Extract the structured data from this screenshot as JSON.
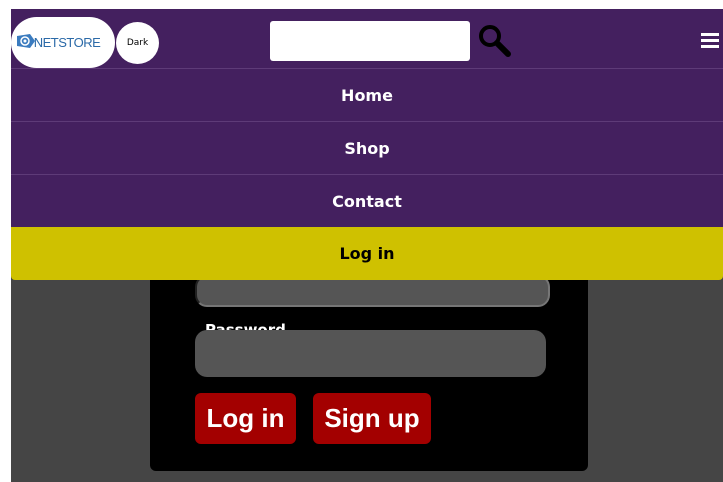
{
  "header": {
    "logo_text": "NETSTORE",
    "theme_toggle_label": "Dark",
    "search": {
      "value": "",
      "placeholder": ""
    }
  },
  "menu": {
    "items": [
      {
        "label": "Home",
        "active": false
      },
      {
        "label": "Shop",
        "active": false
      },
      {
        "label": "Contact",
        "active": false
      },
      {
        "label": "Log in",
        "active": true
      }
    ]
  },
  "login_form": {
    "username": {
      "value": ""
    },
    "password_label": "Password",
    "password": {
      "value": ""
    },
    "login_button": "Log in",
    "signup_button": "Sign up"
  },
  "colors": {
    "header_bg": "#44205f",
    "active_menu_bg": "#cfc100",
    "page_bg": "#454545",
    "card_bg": "#000000",
    "button_bg": "#a30000"
  },
  "icons": [
    "search-icon",
    "hamburger-menu-icon",
    "logo-at-icon"
  ]
}
